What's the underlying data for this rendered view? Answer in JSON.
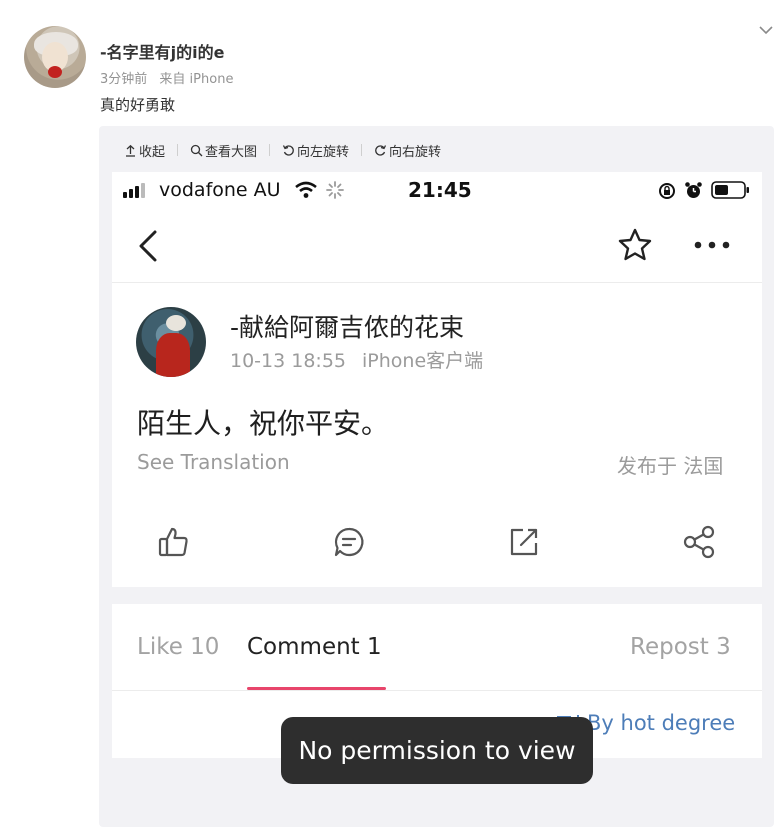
{
  "post": {
    "username": "-名字里有j的i的e",
    "time": "3分钟前",
    "source": "来自 iPhone",
    "text": "真的好勇敢"
  },
  "image_toolbar": {
    "collapse": "收起",
    "view_large": "查看大图",
    "rotate_left": "向左旋转",
    "rotate_right": "向右旋转"
  },
  "phone": {
    "status_bar": {
      "carrier": "vodafone AU",
      "time": "21:45"
    },
    "author": {
      "name": "-献給阿爾吉侬的花束",
      "date": "10-13 18:55",
      "client": "iPhone客户端"
    },
    "content": "陌生人，祝你平安。",
    "see_translation": "See Translation",
    "location": "发布于 法国",
    "actions": [
      "like-icon",
      "comment-icon",
      "repost-icon",
      "share-icon"
    ],
    "tabs": {
      "like": "Like 10",
      "comment": "Comment 1",
      "repost": "Repost 3"
    },
    "sort_label": "By hot degree",
    "toast": "No permission to view",
    "accent_color": "#e8456b",
    "link_color": "#4d7db8"
  }
}
